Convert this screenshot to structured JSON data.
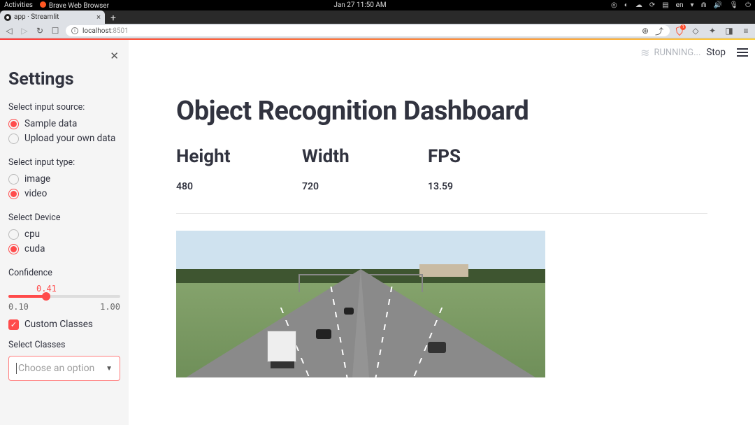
{
  "system": {
    "activities": "Activities",
    "browser_name": "Brave Web Browser",
    "datetime": "Jan 27  11:50 AM",
    "lang": "en"
  },
  "browser": {
    "tab_title": "app · Streamlit",
    "url_host": "localhost",
    "url_port": ":8501"
  },
  "header": {
    "running": "RUNNING...",
    "stop": "Stop"
  },
  "sidebar": {
    "title": "Settings",
    "source_label": "Select input source:",
    "source_options": [
      "Sample data",
      "Upload your own data"
    ],
    "source_selected": 0,
    "type_label": "Select input type:",
    "type_options": [
      "image",
      "video"
    ],
    "type_selected": 1,
    "device_label": "Select Device",
    "device_options": [
      "cpu",
      "cuda"
    ],
    "device_selected": 1,
    "confidence_label": "Confidence",
    "confidence_value": "0.41",
    "confidence_min": "0.10",
    "confidence_max": "1.00",
    "confidence_pct": 34,
    "custom_classes_label": "Custom Classes",
    "custom_classes_checked": true,
    "classes_label": "Select Classes",
    "classes_placeholder": "Choose an option"
  },
  "main": {
    "title": "Object Recognition Dashboard",
    "metrics": [
      {
        "label": "Height",
        "value": "480"
      },
      {
        "label": "Width",
        "value": "720"
      },
      {
        "label": "FPS",
        "value": "13.59"
      }
    ]
  }
}
